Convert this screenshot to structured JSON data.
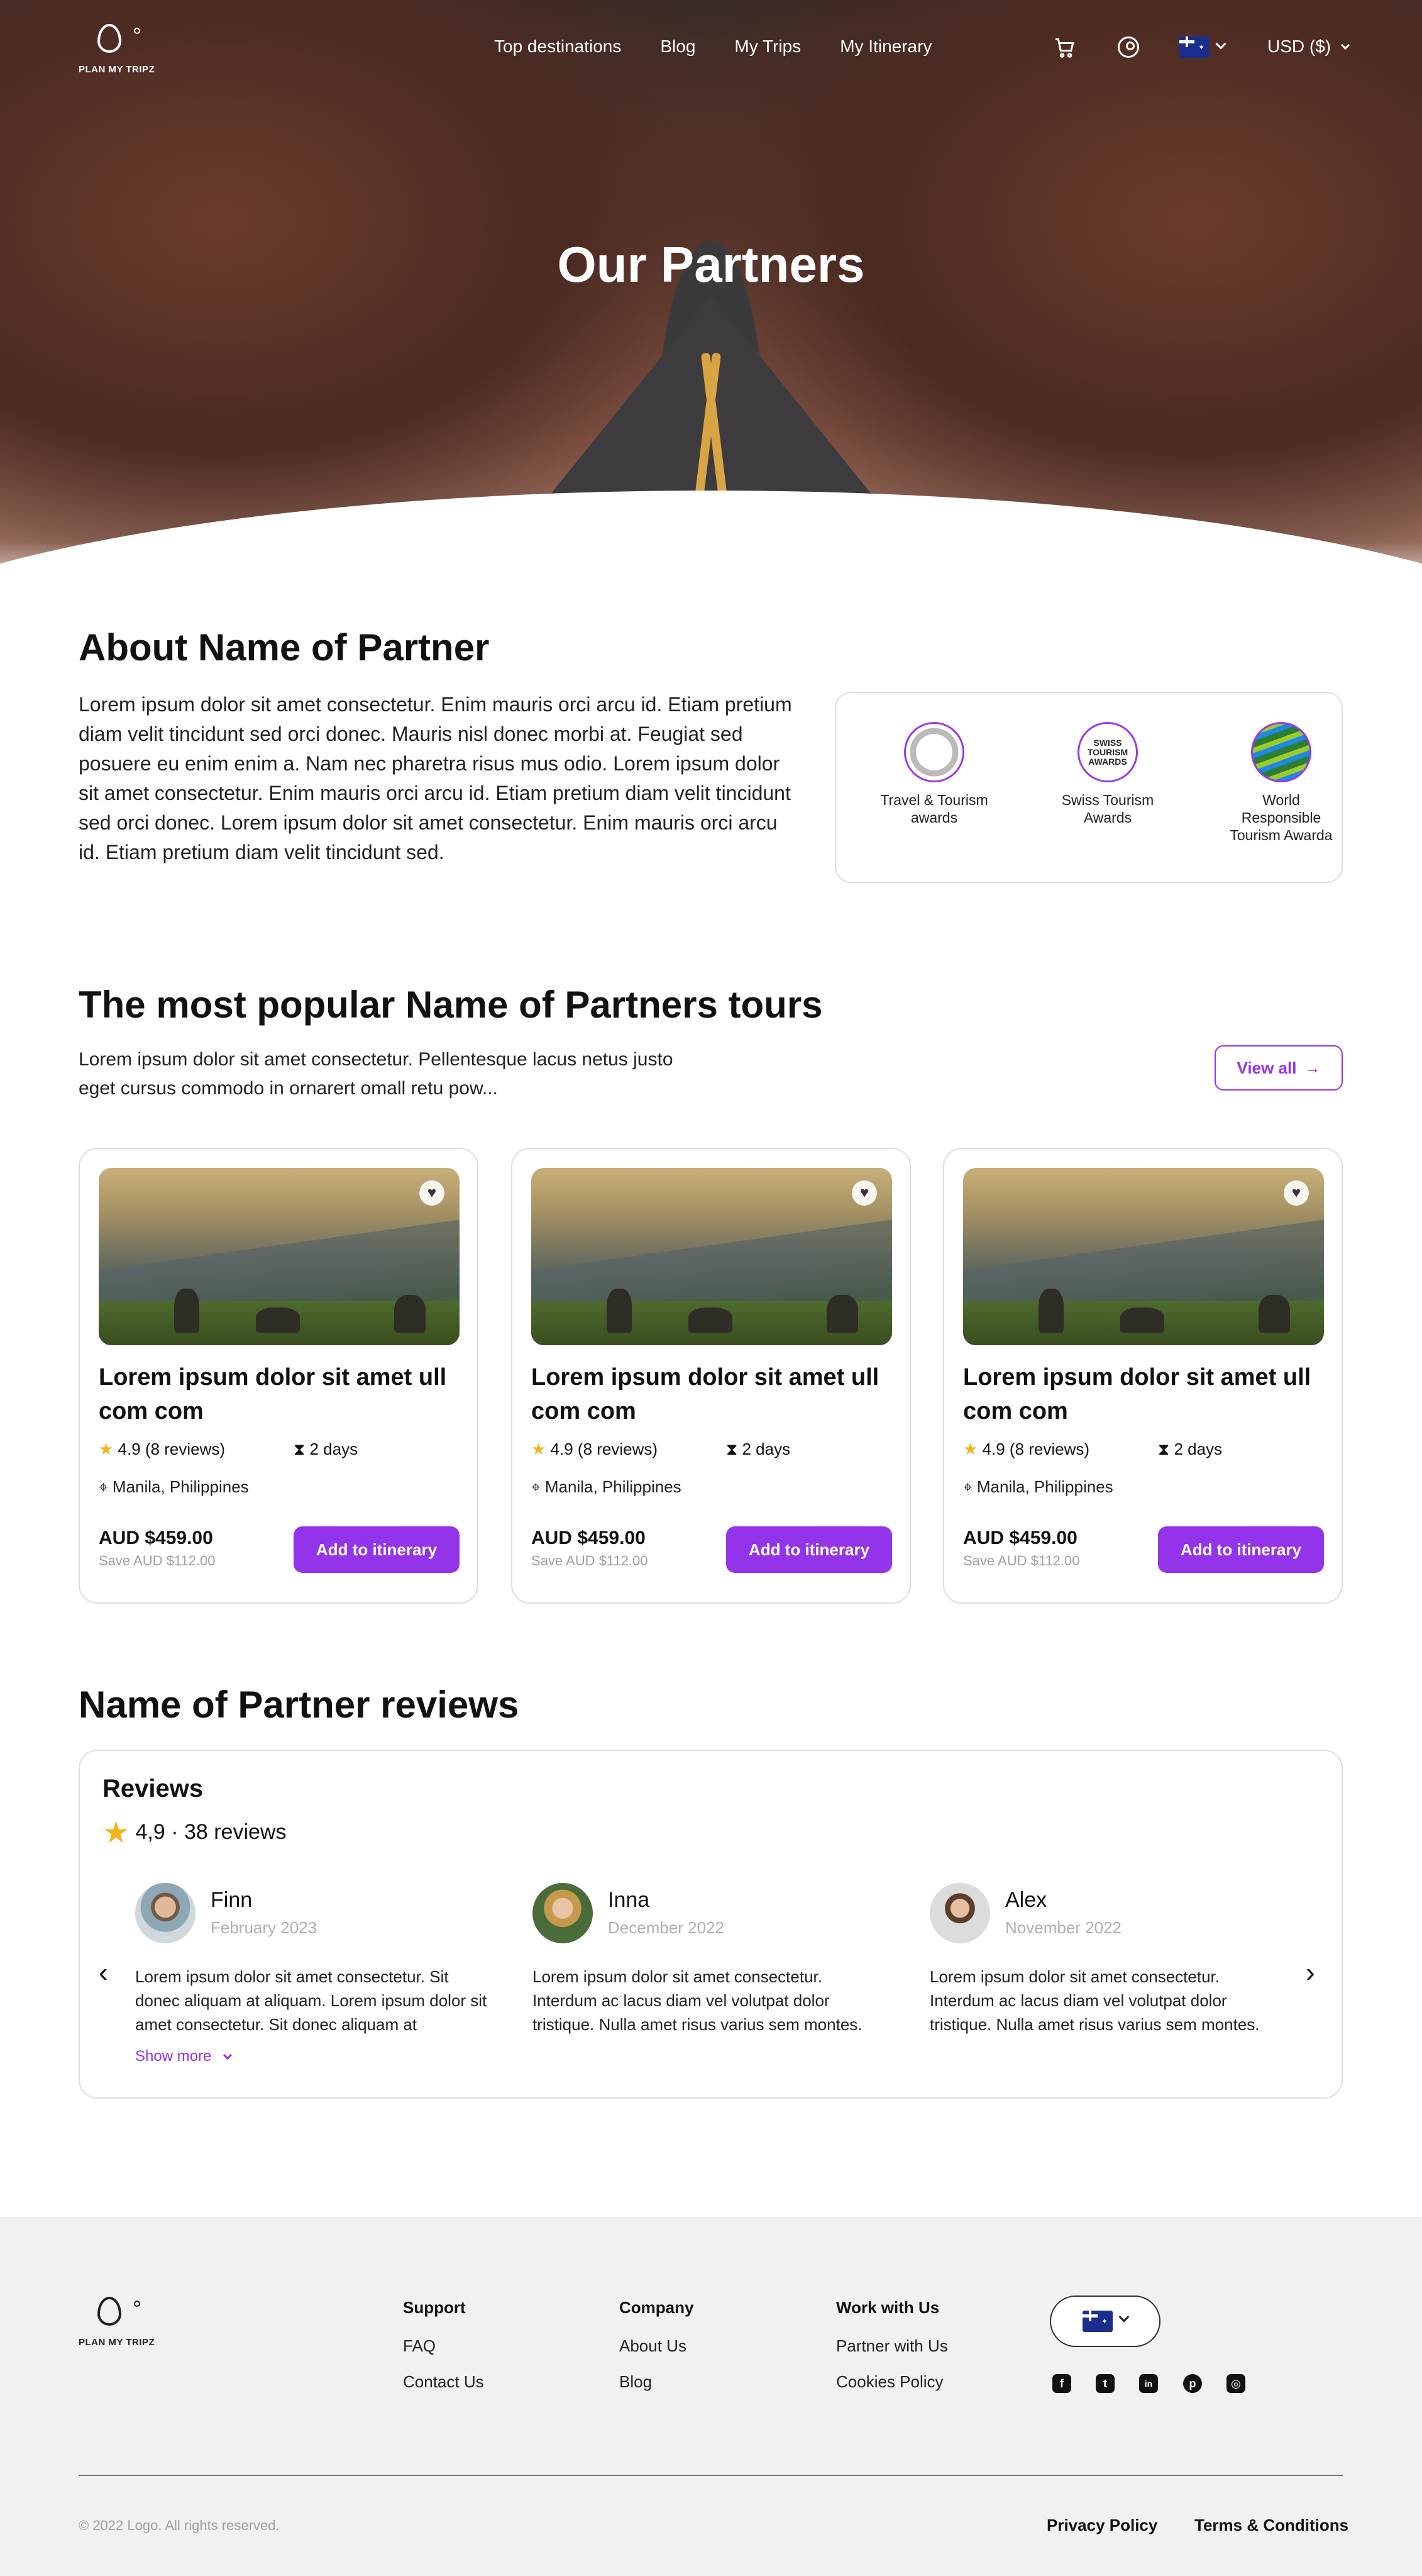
{
  "header": {
    "logo_text": "PLAN MY TRIPZ",
    "nav": [
      "Top destinations",
      "Blog",
      "My Trips",
      "My Itinerary"
    ],
    "currency": "USD ($)"
  },
  "hero": {
    "title": "Our Partners"
  },
  "about": {
    "title": "About Name of Partner",
    "text": "Lorem ipsum dolor sit amet consectetur. Enim mauris orci arcu id. Etiam pretium diam velit tincidunt sed orci donec. Mauris nisl donec morbi at. Feugiat sed posuere eu enim enim a. Nam nec pharetra risus mus odio. Lorem ipsum dolor sit amet consectetur. Enim mauris orci arcu id. Etiam pretium diam velit tincidunt sed orci donec. Lorem ipsum dolor sit amet consectetur. Enim mauris orci arcu id. Etiam pretium diam velit tincidunt sed.",
    "awards": [
      {
        "label": "Travel & Tourism awards"
      },
      {
        "label": "Swiss Tourism Awards",
        "badge": "SWISS TOURISM AWARDS"
      },
      {
        "label": "World Responsible Tourism Awarda"
      }
    ]
  },
  "tours": {
    "title": "The most popular Name of Partners tours",
    "subtitle": "Lorem ipsum dolor sit amet consectetur. Pellentesque lacus netus justo eget cursus commodo in ornarert omall retu pow...",
    "view_all": "View all",
    "cards": [
      {
        "title": "Lorem ipsum dolor sit amet ull com com",
        "rating": "4.9 (8 reviews)",
        "duration": "2 days",
        "location": "Manila, Philippines",
        "price": "AUD $459.00",
        "save": "Save AUD $112.00",
        "button": "Add to itinerary"
      },
      {
        "title": "Lorem ipsum dolor sit amet ull com com",
        "rating": "4.9 (8 reviews)",
        "duration": "2 days",
        "location": "Manila, Philippines",
        "price": "AUD $459.00",
        "save": "Save AUD $112.00",
        "button": "Add to itinerary"
      },
      {
        "title": "Lorem ipsum dolor sit amet ull com com",
        "rating": "4.9 (8 reviews)",
        "duration": "2 days",
        "location": "Manila, Philippines",
        "price": "AUD $459.00",
        "save": "Save AUD $112.00",
        "button": "Add to itinerary"
      }
    ]
  },
  "reviews": {
    "title": "Name of Partner reviews",
    "box_title": "Reviews",
    "summary": "4,9 · 38 reviews",
    "items": [
      {
        "name": "Finn",
        "date": "February 2023",
        "text": "Lorem ipsum dolor sit amet consectetur. Sit donec aliquam at aliquam. Lorem ipsum dolor sit amet consectetur. Sit donec aliquam at",
        "more": "Show more"
      },
      {
        "name": "Inna",
        "date": "December 2022",
        "text": "Lorem ipsum dolor sit amet consectetur. Interdum ac lacus diam vel volutpat dolor tristique. Nulla amet risus varius sem montes."
      },
      {
        "name": "Alex",
        "date": "November 2022",
        "text": "Lorem ipsum dolor sit amet consectetur. Interdum ac lacus diam vel volutpat dolor tristique. Nulla amet risus varius sem montes."
      }
    ]
  },
  "footer": {
    "logo_text": "PLAN MY TRIPZ",
    "columns": [
      {
        "heading": "Support",
        "links": [
          "FAQ",
          "Contact Us"
        ]
      },
      {
        "heading": "Company",
        "links": [
          "About Us",
          "Blog"
        ]
      },
      {
        "heading": "Work with Us",
        "links": [
          "Partner with Us",
          "Cookies Policy"
        ]
      }
    ],
    "social": [
      "facebook-icon",
      "twitter-icon",
      "linkedin-icon",
      "pinterest-icon",
      "instagram-icon"
    ],
    "copyright": "© 2022 Logo. All rights reserved.",
    "privacy": "Privacy Policy",
    "terms": "Terms & Conditions"
  },
  "colors": {
    "accent": "#9333ea",
    "star": "#f5b41b"
  }
}
